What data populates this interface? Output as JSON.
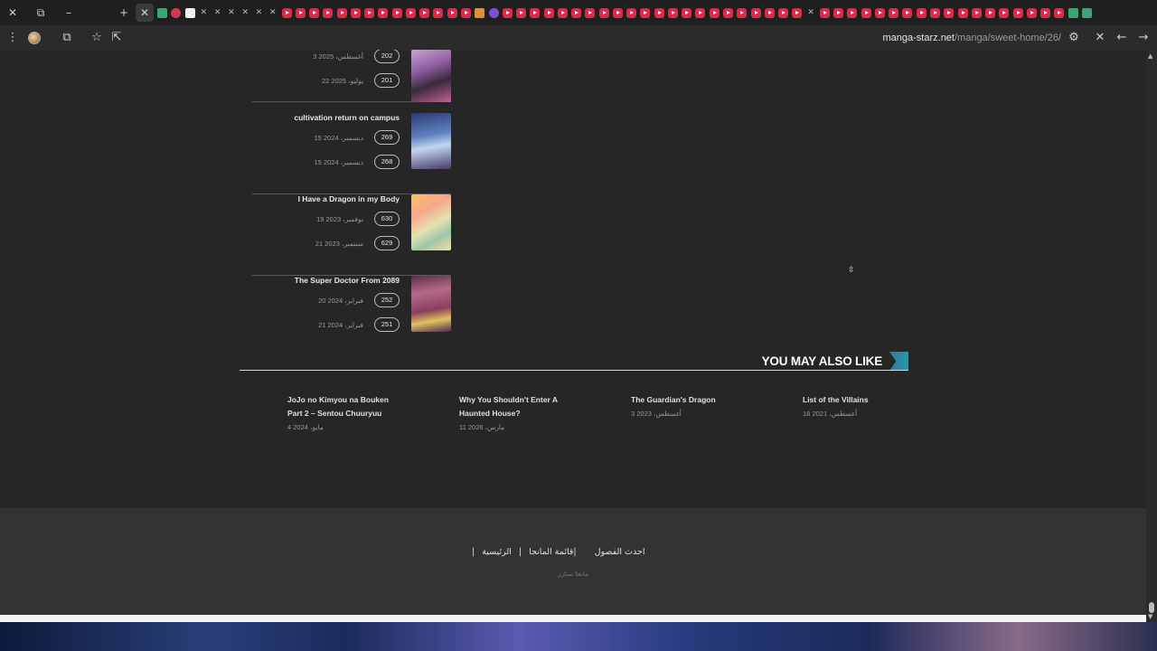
{
  "browser": {
    "url_host": "manga-starz.net",
    "url_path": "/manga/sweet-home/26/",
    "tab_icons": [
      "m-icon",
      "pinterest-icon",
      "amazon-icon",
      "x-icon",
      "x-icon",
      "x-icon",
      "x-icon",
      "x-icon",
      "x-icon",
      "youtube-icon",
      "youtube-icon",
      "youtube-icon",
      "youtube-icon",
      "youtube-icon",
      "youtube-icon",
      "youtube-icon",
      "youtube-icon",
      "youtube-icon",
      "youtube-icon",
      "youtube-icon",
      "youtube-icon",
      "youtube-icon",
      "youtube-icon",
      "orange-icon",
      "violet-icon",
      "youtube-icon",
      "youtube-icon",
      "youtube-icon",
      "youtube-icon",
      "youtube-icon",
      "youtube-icon",
      "youtube-icon",
      "youtube-icon",
      "youtube-icon",
      "youtube-icon",
      "youtube-icon",
      "youtube-icon",
      "youtube-icon",
      "youtube-icon",
      "youtube-icon",
      "youtube-icon",
      "youtube-icon",
      "youtube-icon",
      "youtube-icon",
      "youtube-icon",
      "youtube-icon",
      "youtube-icon",
      "x-icon",
      "youtube-icon",
      "youtube-icon",
      "youtube-icon",
      "youtube-icon",
      "youtube-icon",
      "youtube-icon",
      "youtube-icon",
      "youtube-icon",
      "youtube-icon",
      "youtube-icon",
      "youtube-icon",
      "youtube-icon",
      "youtube-icon",
      "youtube-icon",
      "youtube-icon",
      "youtube-icon",
      "youtube-icon",
      "youtube-icon",
      "m-icon",
      "m-icon"
    ]
  },
  "mangas": [
    {
      "title": "",
      "chapters": [
        {
          "num": "202",
          "date": "3 أغسطس، 2025"
        },
        {
          "num": "201",
          "date": "22 يوليو، 2025"
        }
      ]
    },
    {
      "title": "cultivation return on campus",
      "chapters": [
        {
          "num": "269",
          "date": "15 ديسمبر، 2024"
        },
        {
          "num": "268",
          "date": "15 ديسمبر، 2024"
        }
      ]
    },
    {
      "title": "I Have a Dragon in my Body",
      "chapters": [
        {
          "num": "630",
          "date": "19 نوفمبر، 2023"
        },
        {
          "num": "629",
          "date": "21 سبتمبر، 2023"
        }
      ]
    },
    {
      "title": "The Super Doctor From 2089",
      "chapters": [
        {
          "num": "252",
          "date": "20 فبراير، 2024"
        },
        {
          "num": "251",
          "date": "21 فبراير، 2024"
        }
      ]
    }
  ],
  "you_may_also_like": {
    "heading": "YOU MAY ALSO LIKE",
    "items": [
      {
        "title": "JoJo no Kimyou na Bouken Part 2 – Sentou Chuuryuu",
        "date": "4 مايو، 2024"
      },
      {
        "title": "Why You Shouldn't Enter A Haunted House?",
        "date": "11 مارس، 2026"
      },
      {
        "title": "The Guardian's Dragon",
        "date": "3 أغسطس، 2023"
      },
      {
        "title": "List of the Villains",
        "date": "18 أغسطس، 2021"
      }
    ]
  },
  "footer": {
    "nav": [
      "احدث الفصول",
      "قائمة المانجا",
      "الرئيسية"
    ],
    "copyright": "مانجا ستارز"
  }
}
